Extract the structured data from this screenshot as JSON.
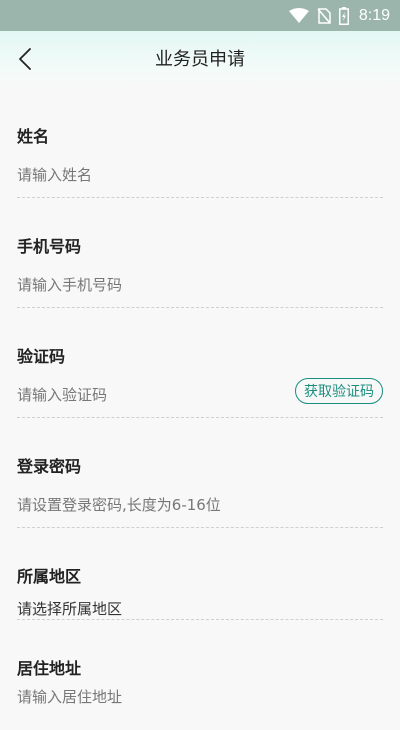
{
  "status_bar": {
    "time": "8:19",
    "icons": [
      "wifi-icon",
      "no-sim-icon",
      "battery-icon"
    ]
  },
  "header": {
    "title": "业务员申请",
    "back_icon": "chevron-left-icon"
  },
  "form": {
    "name": {
      "label": "姓名",
      "placeholder": "请输入姓名"
    },
    "phone": {
      "label": "手机号码",
      "placeholder": "请输入手机号码"
    },
    "code": {
      "label": "验证码",
      "placeholder": "请输入验证码",
      "button": "获取验证码"
    },
    "password": {
      "label": "登录密码",
      "placeholder": "请设置登录密码,长度为6-16位"
    },
    "region": {
      "label": "所属地区",
      "value": "请选择所属地区"
    },
    "address": {
      "label": "居住地址",
      "placeholder": "请输入居住地址"
    }
  },
  "colors": {
    "accent": "#1a8f7e",
    "status_bar": "#9bb5ad",
    "background": "#f8f8f8"
  }
}
